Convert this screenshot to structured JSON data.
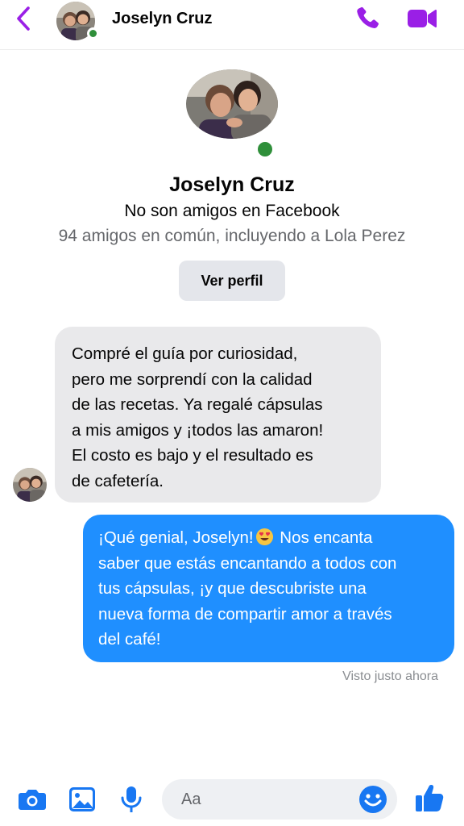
{
  "theme": {
    "accent": "#9a1fe6",
    "outgoing_bubble": "#1f8fff",
    "incoming_bubble": "#e9e9eb",
    "online": "#2f8f3a",
    "composer_icons": "#1877f2"
  },
  "header": {
    "contact_name": "Joselyn Cruz",
    "back_icon": "chevron-left-icon",
    "call_icon": "phone-icon",
    "video_icon": "video-camera-icon"
  },
  "profile": {
    "name": "Joselyn Cruz",
    "relation": "No son amigos en Facebook",
    "mutual_friends": "94 amigos en común, incluyendo a Lola Perez",
    "view_profile_label": "Ver perfil"
  },
  "messages": {
    "incoming": {
      "lines": [
        "Compré el guía por curiosidad,",
        "pero me sorprendí con la calidad",
        "de las recetas. Ya regalé cápsulas",
        "a mis amigos y ¡todos las amaron!",
        "El costo es bajo y el resultado es",
        "de cafetería."
      ]
    },
    "outgoing": {
      "line1_before_emoji": "¡Qué genial, Joselyn!",
      "emoji": "smiling-face-with-heart-eyes",
      "line1_after_emoji": " Nos encanta",
      "lines": [
        "saber que estás encantando a todos con",
        "tus cápsulas, ¡y que descubriste una",
        "nueva forma de compartir amor a través",
        "del café!"
      ]
    },
    "seen_status": "Visto justo ahora"
  },
  "composer": {
    "placeholder": "Aa",
    "icons": [
      "camera-icon",
      "photo-icon",
      "microphone-icon",
      "emoji-icon",
      "thumbs-up-icon"
    ]
  }
}
